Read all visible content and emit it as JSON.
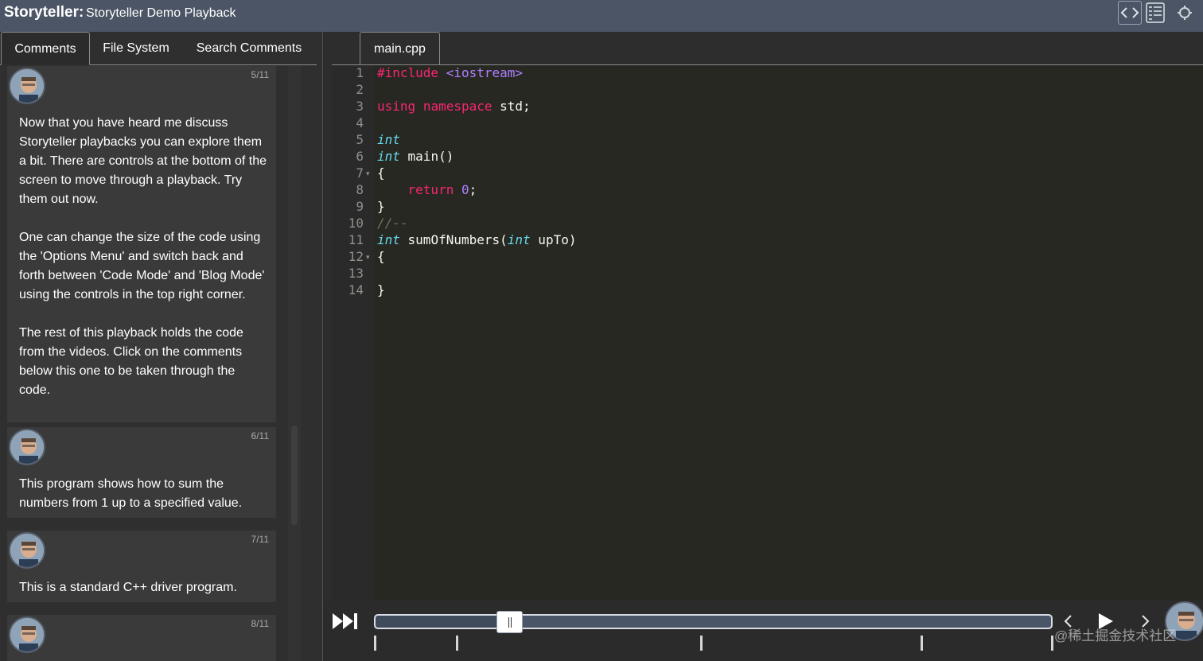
{
  "header": {
    "app_name": "Storyteller:",
    "playback_title": "Storyteller Demo Playback"
  },
  "tabs": {
    "comments": "Comments",
    "file_system": "File System",
    "search": "Search Comments"
  },
  "comments": [
    {
      "position": "5/11",
      "text": "Now that you have heard me discuss Storyteller playbacks you can explore them a bit. There are controls at the bottom of the screen to move through a playback. Try them out now.\n\nOne can change the size of the code using the 'Options Menu' and switch back and forth between 'Code Mode' and 'Blog Mode' using the controls in the top right corner.\n\nThe rest of this playback holds the code from the videos. Click on the comments below this one to be taken through the code."
    },
    {
      "position": "6/11",
      "text": "This program shows how to sum the numbers from 1 up to a specified value."
    },
    {
      "position": "7/11",
      "text": "This is a standard C++ driver program."
    },
    {
      "position": "8/11",
      "text": ""
    }
  ],
  "editor": {
    "file_tab": "main.cpp",
    "line_numbers": [
      "1",
      "2",
      "3",
      "4",
      "5",
      "6",
      "7",
      "8",
      "9",
      "10",
      "11",
      "12",
      "13",
      "14"
    ],
    "code": {
      "l1_pre": "#include",
      "l1_inc": "<iostream>",
      "l3_using": "using",
      "l3_ns": "namespace",
      "l3_rest": " std;",
      "l5_int": "int",
      "l6_int": "int",
      "l6_rest": " main()",
      "l7": "{",
      "l8_ret": "    return",
      "l8_num": "0",
      "l8_semi": ";",
      "l9": "}",
      "l10": "//--",
      "l11_int": "int",
      "l11_mid": " sumOfNumbers(",
      "l11_int2": "int",
      "l11_rest": " upTo)",
      "l12": "{",
      "l14": "}"
    }
  },
  "playback": {
    "progress_fraction": 0.2,
    "watermark": "@稀土掘金技术社区"
  },
  "colors": {
    "header_bg": "#4b5565",
    "editor_bg": "#272822",
    "keyword": "#f92672",
    "type": "#66d9ef",
    "number": "#ae81ff"
  },
  "icons": {
    "code_mode": "code-brackets-icon",
    "blog_mode": "blog-list-icon",
    "settings": "gear-icon",
    "fast_forward": "fast-forward-icon",
    "play": "play-icon",
    "prev": "chevron-left-icon",
    "next": "chevron-right-icon"
  }
}
